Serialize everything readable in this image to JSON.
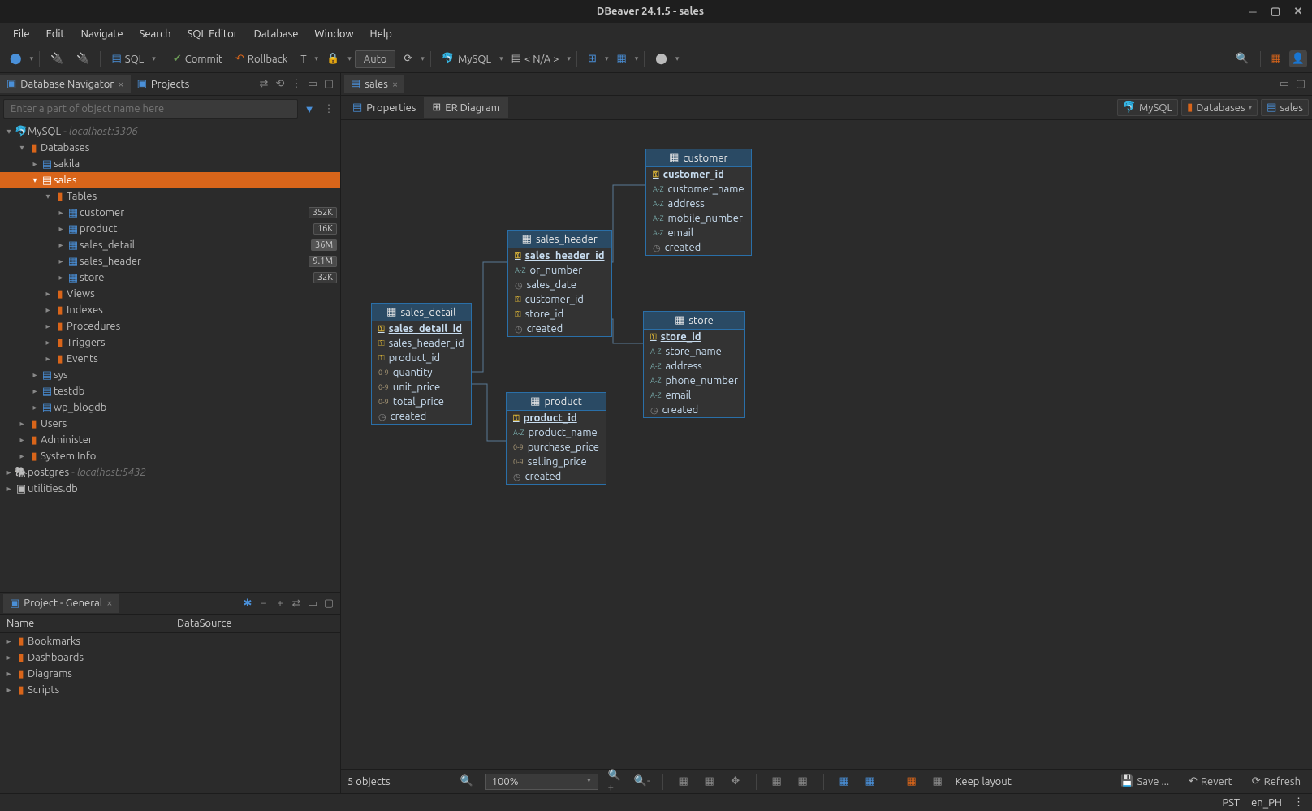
{
  "window": {
    "title": "DBeaver 24.1.5 - sales"
  },
  "menu": [
    "File",
    "Edit",
    "Navigate",
    "Search",
    "SQL Editor",
    "Database",
    "Window",
    "Help"
  ],
  "toolbar": {
    "sql": "SQL",
    "commit": "Commit",
    "rollback": "Rollback",
    "auto": "Auto",
    "driver": "MySQL",
    "schema": "< N/A >"
  },
  "nav": {
    "tab1": "Database Navigator",
    "tab2": "Projects",
    "search_placeholder": "Enter a part of object name here",
    "root": {
      "label": "MySQL",
      "host": " - localhost:3306"
    },
    "databases": "Databases",
    "dbs": [
      "sakila"
    ],
    "selected": "sales",
    "tables_label": "Tables",
    "tables": [
      {
        "name": "customer",
        "rows": "352K"
      },
      {
        "name": "product",
        "rows": "16K"
      },
      {
        "name": "sales_detail",
        "rows": "36M"
      },
      {
        "name": "sales_header",
        "rows": "9.1M"
      },
      {
        "name": "store",
        "rows": "32K"
      }
    ],
    "folders": [
      "Views",
      "Indexes",
      "Procedures",
      "Triggers",
      "Events"
    ],
    "otherdbs": [
      "sys",
      "testdb",
      "wp_blogdb"
    ],
    "sections": [
      "Users",
      "Administer",
      "System Info"
    ],
    "conn2": {
      "label": "postgres",
      "host": " - localhost:5432"
    },
    "conn3": "utilities.db"
  },
  "project": {
    "title": "Project - General",
    "col1": "Name",
    "col2": "DataSource",
    "items": [
      "Bookmarks",
      "Dashboards",
      "Diagrams",
      "Scripts"
    ]
  },
  "editor": {
    "tab": "sales",
    "sub1": "Properties",
    "sub2": "ER Diagram",
    "bc": [
      "MySQL",
      "Databases",
      "sales"
    ]
  },
  "entities": {
    "customer": {
      "title": "customer",
      "pk": "customer_id",
      "cols": [
        [
          "az",
          "customer_name"
        ],
        [
          "az",
          "address"
        ],
        [
          "az",
          "mobile_number"
        ],
        [
          "az",
          "email"
        ],
        [
          "clk",
          "created"
        ]
      ]
    },
    "sales_header": {
      "title": "sales_header",
      "pk": "sales_header_id",
      "cols": [
        [
          "az",
          "or_number"
        ],
        [
          "clk",
          "sales_date"
        ],
        [
          "key",
          "customer_id"
        ],
        [
          "key",
          "store_id"
        ],
        [
          "clk",
          "created"
        ]
      ]
    },
    "sales_detail": {
      "title": "sales_detail",
      "pk": "sales_detail_id",
      "cols": [
        [
          "key",
          "sales_header_id"
        ],
        [
          "key",
          "product_id"
        ],
        [
          "num",
          "quantity"
        ],
        [
          "num",
          "unit_price"
        ],
        [
          "num",
          "total_price"
        ],
        [
          "clk",
          "created"
        ]
      ]
    },
    "store": {
      "title": "store",
      "pk": "store_id",
      "cols": [
        [
          "az",
          "store_name"
        ],
        [
          "az",
          "address"
        ],
        [
          "az",
          "phone_number"
        ],
        [
          "az",
          "email"
        ],
        [
          "clk",
          "created"
        ]
      ]
    },
    "product": {
      "title": "product",
      "pk": "product_id",
      "cols": [
        [
          "az",
          "product_name"
        ],
        [
          "num",
          "purchase_price"
        ],
        [
          "num",
          "selling_price"
        ],
        [
          "clk",
          "created"
        ]
      ]
    }
  },
  "status": {
    "objects": "5 objects",
    "zoom": "100%",
    "keep": "Keep layout",
    "save": "Save ...",
    "revert": "Revert",
    "refresh": "Refresh"
  },
  "footer": {
    "tz": "PST",
    "locale": "en_PH"
  }
}
